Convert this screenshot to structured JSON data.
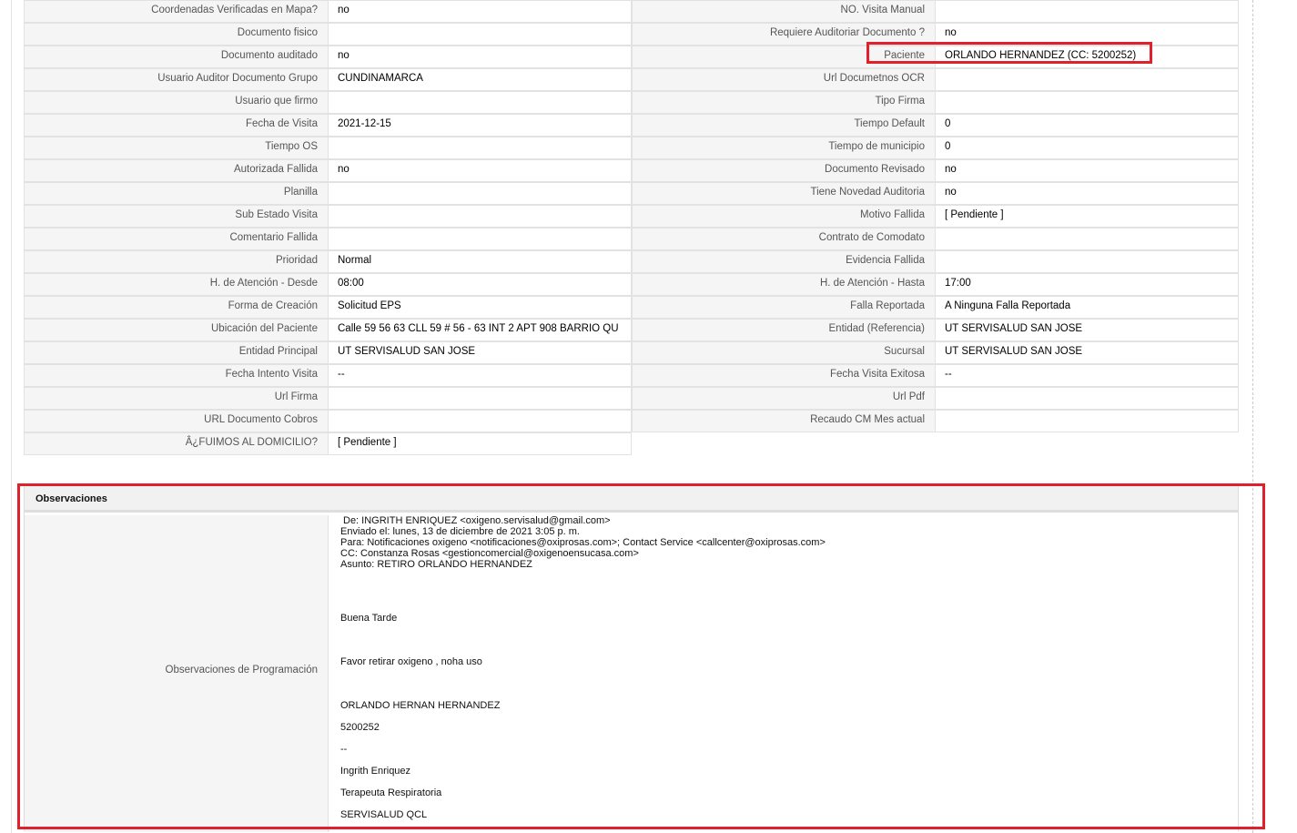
{
  "left_rows": [
    {
      "label": "Coordenadas Verificadas en Mapa?",
      "value": " no"
    },
    {
      "label": "Documento fisico",
      "value": ""
    },
    {
      "label": "Documento auditado",
      "value": " no"
    },
    {
      "label": "Usuario Auditor Documento Grupo",
      "value": "CUNDINAMARCA"
    },
    {
      "label": "Usuario que firmo",
      "value": ""
    },
    {
      "label": "Fecha de Visita",
      "value": " 2021-12-15"
    },
    {
      "label": "Tiempo OS",
      "value": ""
    },
    {
      "label": "Autorizada Fallida",
      "value": " no"
    },
    {
      "label": "Planilla",
      "value": ""
    },
    {
      "label": "Sub Estado Visita",
      "value": ""
    },
    {
      "label": "Comentario Fallida",
      "value": ""
    },
    {
      "label": "Prioridad",
      "value": "Normal"
    },
    {
      "label": "H. de Atención - Desde",
      "value": "08:00"
    },
    {
      "label": "Forma de Creación",
      "value": "Solicitud EPS"
    },
    {
      "label": "Ubicación del Paciente",
      "value": "Calle 59 56 63 CLL 59 # 56 - 63 INT 2 APT 908 BARRIO QU"
    },
    {
      "label": "Entidad Principal",
      "value": "UT SERVISALUD SAN JOSE"
    },
    {
      "label": "Fecha Intento Visita",
      "value": " --"
    },
    {
      "label": "Url Firma",
      "value": ""
    },
    {
      "label": "URL Documento Cobros",
      "value": ""
    },
    {
      "label": "Â¿FUIMOS AL DOMICILIO?",
      "value": "[ Pendiente ]"
    }
  ],
  "right_rows": [
    {
      "label": "NO. Visita Manual",
      "value": ""
    },
    {
      "label": "Requiere Auditoriar Documento ?",
      "value": " no"
    },
    {
      "label": "Paciente",
      "value": "ORLANDO HERNANDEZ (CC: 5200252)"
    },
    {
      "label": "Url Documetnos OCR",
      "value": ""
    },
    {
      "label": "Tipo Firma",
      "value": ""
    },
    {
      "label": "Tiempo Default",
      "value": "0"
    },
    {
      "label": "Tiempo de municipio",
      "value": "0"
    },
    {
      "label": "Documento Revisado",
      "value": " no"
    },
    {
      "label": "Tiene Novedad Auditoria",
      "value": " no"
    },
    {
      "label": "Motivo Fallida",
      "value": "[ Pendiente ]"
    },
    {
      "label": "Contrato de Comodato",
      "value": ""
    },
    {
      "label": "Evidencia Fallida",
      "value": ""
    },
    {
      "label": "H. de Atención - Hasta",
      "value": "17:00"
    },
    {
      "label": "Falla Reportada",
      "value": "A Ninguna Falla Reportada"
    },
    {
      "label": "Entidad (Referencia)",
      "value": "UT SERVISALUD SAN JOSE"
    },
    {
      "label": "Sucursal",
      "value": "UT SERVISALUD SAN JOSE"
    },
    {
      "label": "Fecha Visita Exitosa",
      "value": " --"
    },
    {
      "label": "Url Pdf",
      "value": ""
    },
    {
      "label": "Recaudo CM Mes actual",
      "value": ""
    }
  ],
  "observaciones": {
    "title": "Observaciones",
    "label": "Observaciones de Programación",
    "email_header": [
      "De: INGRITH ENRIQUEZ <oxigeno.servisalud@gmail.com>",
      "Enviado el: lunes, 13 de diciembre de 2021 3:05 p. m.",
      "Para: Notificaciones oxigeno <notificaciones@oxiprosas.com>; Contact Service <callcenter@oxiprosas.com>",
      "CC: Constanza Rosas <gestioncomercial@oxigenoensucasa.com>",
      "Asunto: RETIRO ORLANDO HERNANDEZ"
    ],
    "greeting": "Buena Tarde",
    "message": "Favor retirar oxigeno , noha uso",
    "name": "ORLANDO HERNAN HERNANDEZ",
    "id_number": "5200252",
    "separator": "--",
    "signature_name": "Ingrith Enriquez",
    "signature_role": "Terapeuta Respiratoria",
    "signature_company": "SERVISALUD QCL"
  }
}
